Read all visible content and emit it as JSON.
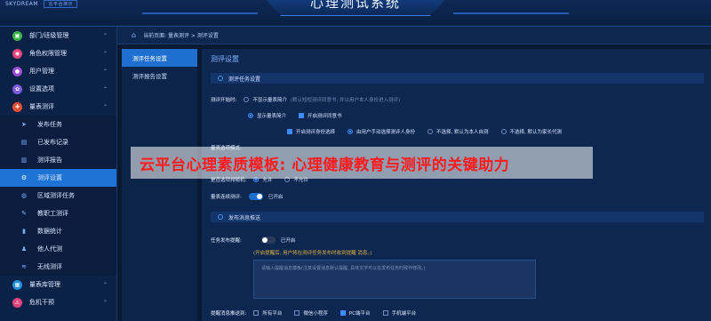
{
  "header": {
    "logo_text": "SKYDREAM",
    "logo_badge": "云平台演示",
    "title": "心理测试系统"
  },
  "breadcrumb": "当前页面: 量表测评 > 测评设置",
  "sidebar": {
    "items": [
      {
        "label": "部门/班级管理",
        "icon": "building-icon",
        "color": "#3ab54a",
        "type": "group"
      },
      {
        "label": "角色权限管理",
        "icon": "role-icon",
        "color": "#e0457b",
        "type": "group"
      },
      {
        "label": "用户管理",
        "icon": "user-icon",
        "color": "#9b4dd8",
        "type": "group"
      },
      {
        "label": "设置选项",
        "icon": "gear-icon",
        "color": "#7a5ce0",
        "type": "group"
      },
      {
        "label": "量表测评",
        "icon": "scale-icon",
        "color": "#e2502f",
        "type": "group"
      },
      {
        "label": "发布任务",
        "icon": "send-icon",
        "type": "sub"
      },
      {
        "label": "已发布记录",
        "icon": "record-icon",
        "type": "sub"
      },
      {
        "label": "测评报告",
        "icon": "report-icon",
        "type": "sub"
      },
      {
        "label": "测评设置",
        "icon": "settings-icon",
        "type": "sub",
        "active": true
      },
      {
        "label": "区域测评任务",
        "icon": "area-icon",
        "type": "sub"
      },
      {
        "label": "教职工测评",
        "icon": "staff-icon",
        "type": "sub"
      },
      {
        "label": "数据统计",
        "icon": "chart-icon",
        "type": "sub"
      },
      {
        "label": "他人代测",
        "icon": "proxy-icon",
        "type": "sub"
      },
      {
        "label": "无线测评",
        "icon": "wifi-icon",
        "type": "sub"
      },
      {
        "label": "量表库管理",
        "icon": "library-icon",
        "color": "#1f8fe0",
        "type": "group"
      },
      {
        "label": "危机干预",
        "icon": "alert-icon",
        "color": "#e0457b",
        "type": "group"
      }
    ]
  },
  "tabs": [
    {
      "label": "测评任务设置",
      "active": true
    },
    {
      "label": "测评报告设置",
      "active": false
    }
  ],
  "main": {
    "title": "测评设置",
    "section1": "测评任务设置",
    "start_label": "测评开始时:",
    "opt_no_intro": "不显示量表简介",
    "opt_no_intro_hint": "(默认短短测评同意书, 并以用户本人身份进入测评)",
    "opt_show_intro": "显示量表简介",
    "opt_consent": "开启测评同意书",
    "opt_identity": "开启测评身份选择",
    "opt_manual": "由用户手动选择测评人身份",
    "opt_default_self": "不选择, 默认为本人自测",
    "opt_default_parent": "不选择, 默认为家长代测",
    "options_label": "量表选项模式:",
    "reorder_label": "是否选项排随机:",
    "reorder_yes": "允许",
    "reorder_no": "不允许",
    "continue_label": "量表连续测评:",
    "continue_state": "已开启",
    "section2": "发布消息推送",
    "push_label": "任务发布提醒:",
    "push_state": "已开启",
    "push_hint": "(开启提醒后, 用户将在测评任务发布时收到提醒 消息。)",
    "textarea_placeholder": "请输入提醒消息模板(注意设置消息默认提醒, 具体文字可以在发布任务时候作修改。)",
    "channel_label": "提醒消息推送到:",
    "channel_all": "所有平台",
    "channel_wechat": "微信小程序",
    "channel_pc": "PC端平台",
    "channel_mobile": "手机端平台"
  },
  "banner": "云平台心理素质模板: 心理健康教育与测评的关键助力"
}
